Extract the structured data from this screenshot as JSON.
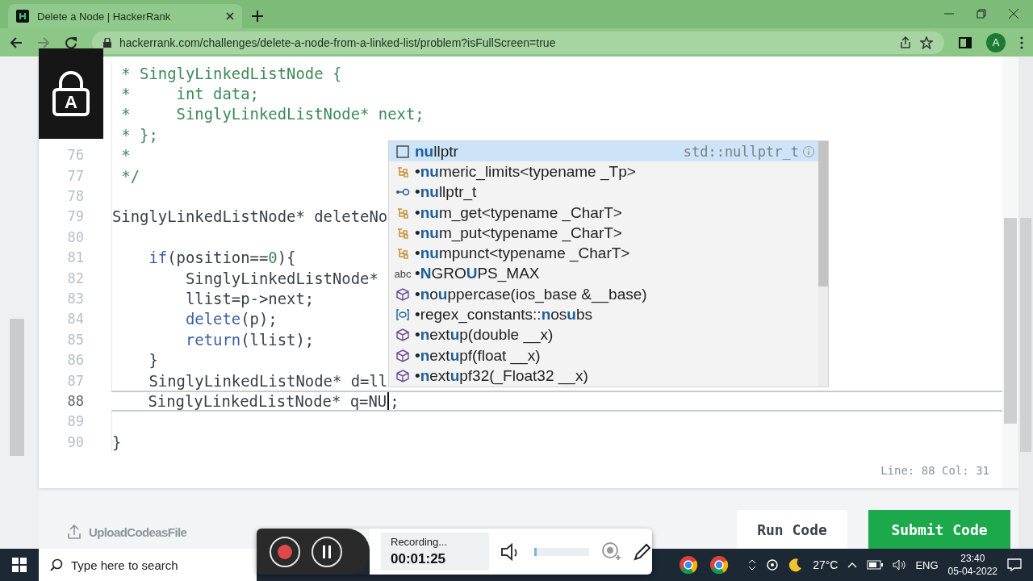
{
  "browser": {
    "tab_title": "Delete a Node | HackerRank",
    "url": "hackerrank.com/challenges/delete-a-node-from-a-linked-list/problem?isFullScreen=true",
    "profile_initial": "A"
  },
  "lock_overlay": {
    "letter": "A"
  },
  "editor": {
    "lines": [
      {
        "current": false,
        "code": [
          {
            "kind": "comment",
            "text": " * SinglyLinkedListNode {"
          }
        ]
      },
      {
        "current": false,
        "code": [
          {
            "kind": "comment",
            "text": " *     int data;"
          }
        ]
      },
      {
        "current": false,
        "code": [
          {
            "kind": "comment",
            "text": " *     SinglyLinkedListNode* next;"
          }
        ]
      },
      {
        "current": false,
        "code": [
          {
            "kind": "comment",
            "text": " * };"
          }
        ]
      },
      {
        "number": "76",
        "current": false,
        "code": [
          {
            "kind": "comment",
            "text": " *"
          }
        ]
      },
      {
        "number": "77",
        "current": false,
        "code": [
          {
            "kind": "comment",
            "text": " */"
          }
        ]
      },
      {
        "number": "78",
        "current": false
      },
      {
        "number": "79",
        "current": false,
        "code": [
          {
            "kind": "plain",
            "text": "SinglyLinkedListNode* deleteNo"
          }
        ]
      },
      {
        "number": "80",
        "current": false
      },
      {
        "number": "81",
        "current": false,
        "code": [
          {
            "kind": "keyword",
            "text": "    if"
          },
          {
            "kind": "plain",
            "text": "(position=="
          },
          {
            "kind": "number",
            "text": "0"
          },
          {
            "kind": "plain",
            "text": "){"
          }
        ]
      },
      {
        "number": "82",
        "current": false,
        "code": [
          {
            "kind": "plain",
            "text": "        SinglyLinkedListNode*"
          }
        ]
      },
      {
        "number": "83",
        "current": false,
        "code": [
          {
            "kind": "plain",
            "text": "        llist=p->next;"
          }
        ]
      },
      {
        "number": "84",
        "current": false,
        "code": [
          {
            "kind": "keyword",
            "text": "        delete"
          },
          {
            "kind": "plain",
            "text": "(p);"
          }
        ]
      },
      {
        "number": "85",
        "current": false,
        "code": [
          {
            "kind": "keyword",
            "text": "        return"
          },
          {
            "kind": "plain",
            "text": "(llist);"
          }
        ]
      },
      {
        "number": "86",
        "current": false,
        "code": [
          {
            "kind": "plain",
            "text": "    }"
          }
        ]
      },
      {
        "number": "87",
        "current": false,
        "code": [
          {
            "kind": "plain",
            "text": "    SinglyLinkedListNode* d=ll"
          }
        ]
      },
      {
        "number": "88",
        "current": true,
        "code": [
          {
            "kind": "plain",
            "text": "    SinglyLinkedListNode* q=NU"
          },
          {
            "kind": "cursor"
          },
          {
            "kind": "plain",
            "text": ";"
          }
        ]
      },
      {
        "number": "89",
        "current": false
      },
      {
        "number": "90",
        "current": false,
        "code": [
          {
            "kind": "plain",
            "text": "}"
          }
        ]
      }
    ],
    "suggestions": [
      {
        "kind": "keyword",
        "label": "**nu**llptr",
        "detail": "std::nullptr_t",
        "selected": true
      },
      {
        "kind": "template",
        "label": "•**nu**meric_limits<typename _Tp>",
        "selected": false
      },
      {
        "kind": "typedef",
        "label": "•**nu**llptr_t",
        "selected": false
      },
      {
        "kind": "template",
        "label": "•**nu**m_get<typename _CharT>",
        "selected": false
      },
      {
        "kind": "template",
        "label": "•**nu**m_put<typename _CharT>",
        "selected": false
      },
      {
        "kind": "template",
        "label": "•**nu**mpunct<typename _CharT>",
        "selected": false
      },
      {
        "kind": "macro",
        "badge": "abc",
        "label": "•**N**GRO**U**PS_MAX",
        "selected": false
      },
      {
        "kind": "function",
        "label": "•**n**o**u**ppercase(ios_base &__base)",
        "selected": false
      },
      {
        "kind": "enum",
        "label": "•regex_constants::**n**os**u**bs",
        "selected": false
      },
      {
        "kind": "function",
        "label": "•**n**ext**u**p(double __x)",
        "selected": false
      },
      {
        "kind": "function",
        "label": "•**n**ext**u**pf(float __x)",
        "selected": false
      },
      {
        "kind": "function",
        "label": "•**n**ext**u**pf32(_Float32 __x)",
        "selected": false
      }
    ],
    "status": "Line: 88 Col: 31"
  },
  "actions": {
    "upload": "UploadCodeasFile",
    "run": "Run Code",
    "submit": "Submit Code"
  },
  "recorder": {
    "status": "Recording...",
    "elapsed": "00:01:25",
    "level": 0.02
  },
  "taskbar": {
    "search_placeholder": "Type here to search",
    "temperature": "27°C",
    "language": "ENG",
    "time": "23:40",
    "date": "05-04-2022"
  }
}
